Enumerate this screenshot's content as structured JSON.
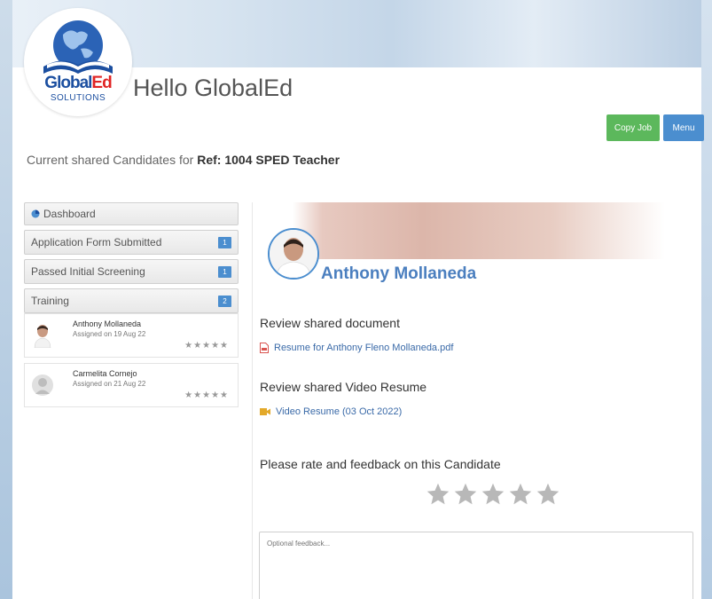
{
  "header": {
    "logo_main": "Global",
    "logo_accent": "Ed",
    "logo_sub": "SOLUTIONS",
    "greeting": "Hello GlobalEd"
  },
  "toolbar": {
    "copy_job_label": "Copy Job",
    "menu_label": "Menu"
  },
  "subtitle": {
    "prefix": "Current shared Candidates for ",
    "ref": "Ref: 1004 SPED Teacher"
  },
  "sidebar": {
    "dashboard_label": "Dashboard",
    "stages": [
      {
        "label": "Application Form Submitted",
        "count": "1"
      },
      {
        "label": "Passed Initial Screening",
        "count": "1"
      },
      {
        "label": "Training",
        "count": "2"
      }
    ],
    "candidates": [
      {
        "name": "Anthony Mollaneda",
        "assigned": "Assigned on 19 Aug 22",
        "stars": "★★★★★"
      },
      {
        "name": "Carmelita Cornejo",
        "assigned": "Assigned on 21 Aug 22",
        "stars": "★★★★★"
      }
    ]
  },
  "candidate": {
    "name": "Anthony Mollaneda",
    "doc_heading": "Review shared document",
    "doc_link": "Resume for Anthony Fleno Mollaneda.pdf",
    "video_heading": "Review shared Video Resume",
    "video_link": "Video Resume (03 Oct 2022)",
    "rate_heading": "Please rate and feedback on this Candidate",
    "feedback_placeholder": "Optional feedback..."
  },
  "colors": {
    "accent": "#4b8ecf",
    "copy_button": "#5cb85c",
    "brand_red": "#e02424"
  }
}
